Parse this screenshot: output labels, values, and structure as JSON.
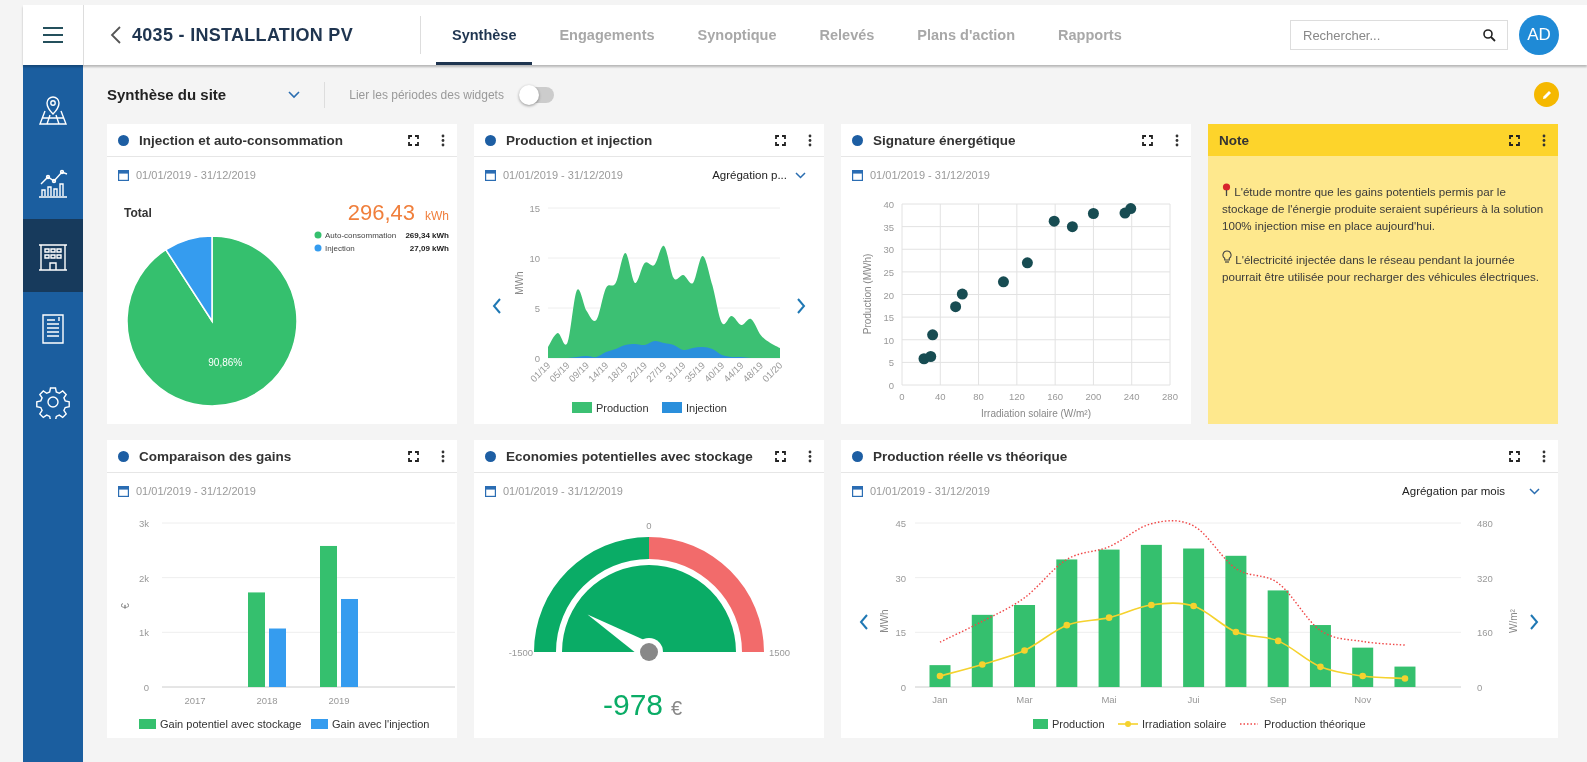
{
  "header": {
    "title": "4035 - INSTALLATION PV",
    "tabs": [
      {
        "label": "Synthèse",
        "selected": true
      },
      {
        "label": "Engagements",
        "selected": false
      },
      {
        "label": "Synoptique",
        "selected": false
      },
      {
        "label": "Relevés",
        "selected": false
      },
      {
        "label": "Plans d'action",
        "selected": false
      },
      {
        "label": "Rapports",
        "selected": false
      }
    ],
    "search": {
      "placeholder": "Rechercher..."
    },
    "avatar": "AD"
  },
  "sidebar": {
    "items": [
      {
        "kind": "map",
        "selected": false
      },
      {
        "kind": "chart",
        "selected": false
      },
      {
        "kind": "building",
        "selected": true
      },
      {
        "kind": "invoice",
        "selected": false
      },
      {
        "kind": "settings",
        "selected": false
      }
    ]
  },
  "toolbar": {
    "view": "Synthèse du site",
    "link_label": "Lier les périodes des widgets",
    "link_on": false
  },
  "widgets": [
    {
      "kind": "pie",
      "title": "Injection et auto-consommation",
      "dates": "01/01/2019 - 31/12/2019",
      "total_label": "Total",
      "total_value": "296,43",
      "total_unit": "kWh",
      "legend_values": [
        "269,34 kWh",
        "27,09 kWh"
      ],
      "chart_data": {
        "type": "pie",
        "categories": [
          "Auto-consommation",
          "Injection"
        ],
        "values": [
          90.86,
          9.14
        ],
        "colors": [
          "#35c06e",
          "#359cef"
        ],
        "value_labels": [
          "90,86%",
          null
        ],
        "legend": "top right"
      }
    },
    {
      "kind": "area",
      "title": "Production et injection",
      "dates": "01/01/2019 - 31/12/2019",
      "aggregation": "Agrégation p...",
      "chart_data": {
        "type": "area",
        "ylabel": "MWh",
        "grid": true,
        "legend": "bottom",
        "ylim": [
          0,
          15
        ],
        "yticks": [
          0,
          5,
          10,
          15
        ],
        "categories": [
          "01/19",
          null,
          "05/19",
          null,
          "09/19",
          null,
          "14/19",
          null,
          "18/19",
          null,
          "22/19",
          null,
          "27/19",
          null,
          "31/19",
          null,
          "35/19",
          null,
          "40/19",
          null,
          "44/19",
          null,
          "48/19",
          null,
          "01/20"
        ],
        "series": [
          {
            "name": "Production",
            "color": "#3cc073",
            "values": [
              1.1,
              2.5,
              1.5,
              6.8,
              4.7,
              3.8,
              7,
              7.5,
              10.5,
              7.5,
              9.5,
              9.3,
              11.2,
              8,
              8.3,
              7.5,
              10.2,
              7.3,
              3.5,
              4.2,
              3.3,
              3.9,
              2.3,
              1.5,
              1
            ]
          },
          {
            "name": "Injection",
            "color": "#2a8fdc",
            "values": [
              0,
              0,
              0,
              0.1,
              0.2,
              0.1,
              0.6,
              0.9,
              1.3,
              1.4,
              1.3,
              1.7,
              1.5,
              1.3,
              0.8,
              1,
              1.1,
              0.9,
              0.3,
              0.1,
              0.1,
              0,
              0,
              0,
              0
            ]
          }
        ]
      }
    },
    {
      "kind": "scatter",
      "title": "Signature énergétique",
      "dates": "01/01/2019 - 31/12/2019",
      "chart_data": {
        "type": "scatter",
        "xlabel": "Irradiation solaire (W/m²)",
        "ylabel": "Production (MWh)",
        "grid": true,
        "xlim": [
          0,
          280
        ],
        "ylim": [
          0,
          40
        ],
        "xticks": [
          0,
          40,
          80,
          120,
          160,
          200,
          240,
          280
        ],
        "yticks": [
          0,
          5,
          10,
          15,
          20,
          25,
          30,
          35,
          40
        ],
        "x": [
          23,
          30,
          32,
          56,
          63,
          106,
          131,
          159,
          178,
          200,
          233,
          239
        ],
        "series": [
          {
            "color": "#174c52",
            "values": [
              5.8,
              6.3,
              11.1,
              17.3,
              20.1,
              22.8,
              27,
              36.2,
              35,
              37.9,
              38,
              39
            ]
          }
        ]
      }
    },
    {
      "kind": "note",
      "title": "Note",
      "paragraphs": [
        "L'étude montre que les gains potentiels permis par le stockage de l'énergie produite seraient supérieurs à la solution 100% injection mise en place aujourd'hui.",
        "L'électricité injectée dans le réseau pendant la journée pourrait être utilisée pour recharger des véhicules électriques."
      ]
    },
    {
      "kind": "bars",
      "title": "Comparaison des gains",
      "dates": "01/01/2019 - 31/12/2019",
      "chart_data": {
        "type": "bar",
        "ylabel": "€",
        "grid": true,
        "legend": "bottom",
        "categories": [
          "2017",
          "2018",
          "2019"
        ],
        "ylim": [
          0,
          3000
        ],
        "yticks": [
          {
            "value": 0,
            "label": "0"
          },
          {
            "value": 1000,
            "label": "1k"
          },
          {
            "value": 2000,
            "label": "2k"
          },
          {
            "value": 3000,
            "label": "3k"
          }
        ],
        "series": [
          {
            "name": "Gain potentiel avec stockage",
            "color": "#35c06e",
            "values": [
              null,
              1730,
              2580
            ]
          },
          {
            "name": "Gain avec l'injection",
            "color": "#359cef",
            "values": [
              null,
              1070,
              1610
            ]
          }
        ]
      }
    },
    {
      "kind": "gauge",
      "title": "Economies potentielles avec stockage",
      "dates": "01/01/2019 - 31/12/2019",
      "min_label": "-1500",
      "mid_label": "0",
      "max_label": "1500",
      "value": "-978",
      "unit": "€"
    },
    {
      "kind": "combo",
      "title": "Production réelle vs théorique",
      "dates": "01/01/2019 - 31/12/2019",
      "aggregation": "Agrégation par mois",
      "chart_data": {
        "type": "bar",
        "ylabel": "MWh",
        "y2label": "W/m²",
        "grid": true,
        "legend": "bottom",
        "categories": [
          "Jan",
          null,
          "Mar",
          null,
          "Mai",
          null,
          "Jui",
          null,
          "Sep",
          null,
          "Nov",
          null
        ],
        "ylim": [
          0,
          45
        ],
        "yticks": [
          0,
          15,
          30,
          45
        ],
        "y2lim": [
          0,
          480
        ],
        "y2ticks": [
          0,
          160,
          320,
          480
        ],
        "series": [
          {
            "name": "Production",
            "type": "bar",
            "color": "#35c06e",
            "values": [
              6,
              19.8,
              22.5,
              35,
              37.7,
              39,
              38,
              36,
              26.5,
              17,
              10.8,
              5.6
            ]
          },
          {
            "name": "Irradiation solaire",
            "type": "line",
            "axis": "y2",
            "marker": true,
            "color": "#f5d22e",
            "values": [
              32,
              66,
              107,
              181,
              203,
              240,
              237,
              161,
              135,
              59,
              32,
              25
            ]
          },
          {
            "name": "Production théorique",
            "type": "line",
            "line_style": "dotted",
            "color": "#f04545",
            "values": [
              12.3,
              18,
              24.5,
              35,
              38.5,
              44.8,
              44.2,
              32.5,
              28.5,
              15.5,
              12.5,
              11.5
            ]
          }
        ]
      }
    }
  ]
}
